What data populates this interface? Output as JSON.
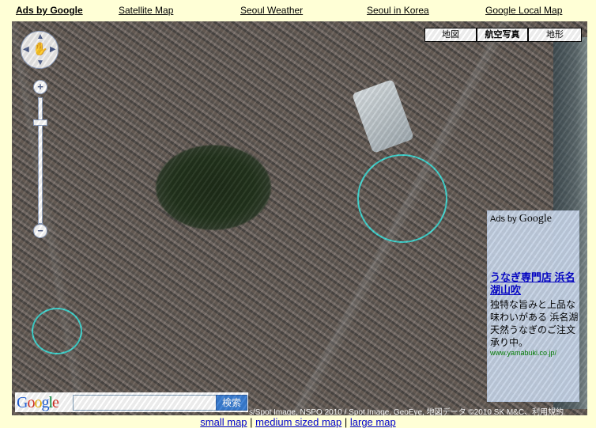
{
  "top_links": [
    "Ads by Google",
    "Satellite Map",
    "Seoul Weather",
    "Seoul in Korea",
    "Google Local Map"
  ],
  "map_types": {
    "map": "地図",
    "satellite": "航空写真",
    "terrain": "地形",
    "active": "satellite"
  },
  "zoom": {
    "in_label": "+",
    "out_label": "−"
  },
  "ad": {
    "header_prefix": "Ads by",
    "header_brand": "Google",
    "title": "うなぎ専門店 浜名湖山吹",
    "body": "独特な旨みと上品な味わいがある 浜名湖天然うなぎのご注文承り中。",
    "url": "www.yamabuki.co.jp/"
  },
  "search": {
    "logo": "Google",
    "button": "検索",
    "value": ""
  },
  "copyright": {
    "text": "s/Spot Image, NSPO 2010 / Spot Image, GeoEye, 地図データ ©2010 SK M&C",
    "terms": "利用規約"
  },
  "bottom_links": [
    "small map",
    "medium sized map",
    "large map"
  ],
  "bottom_separator": " | ",
  "colors": {
    "background": "#ffffd6",
    "circle": "#3fd6d0",
    "ad_background": "#cddcf0",
    "link": "#0000cc"
  }
}
